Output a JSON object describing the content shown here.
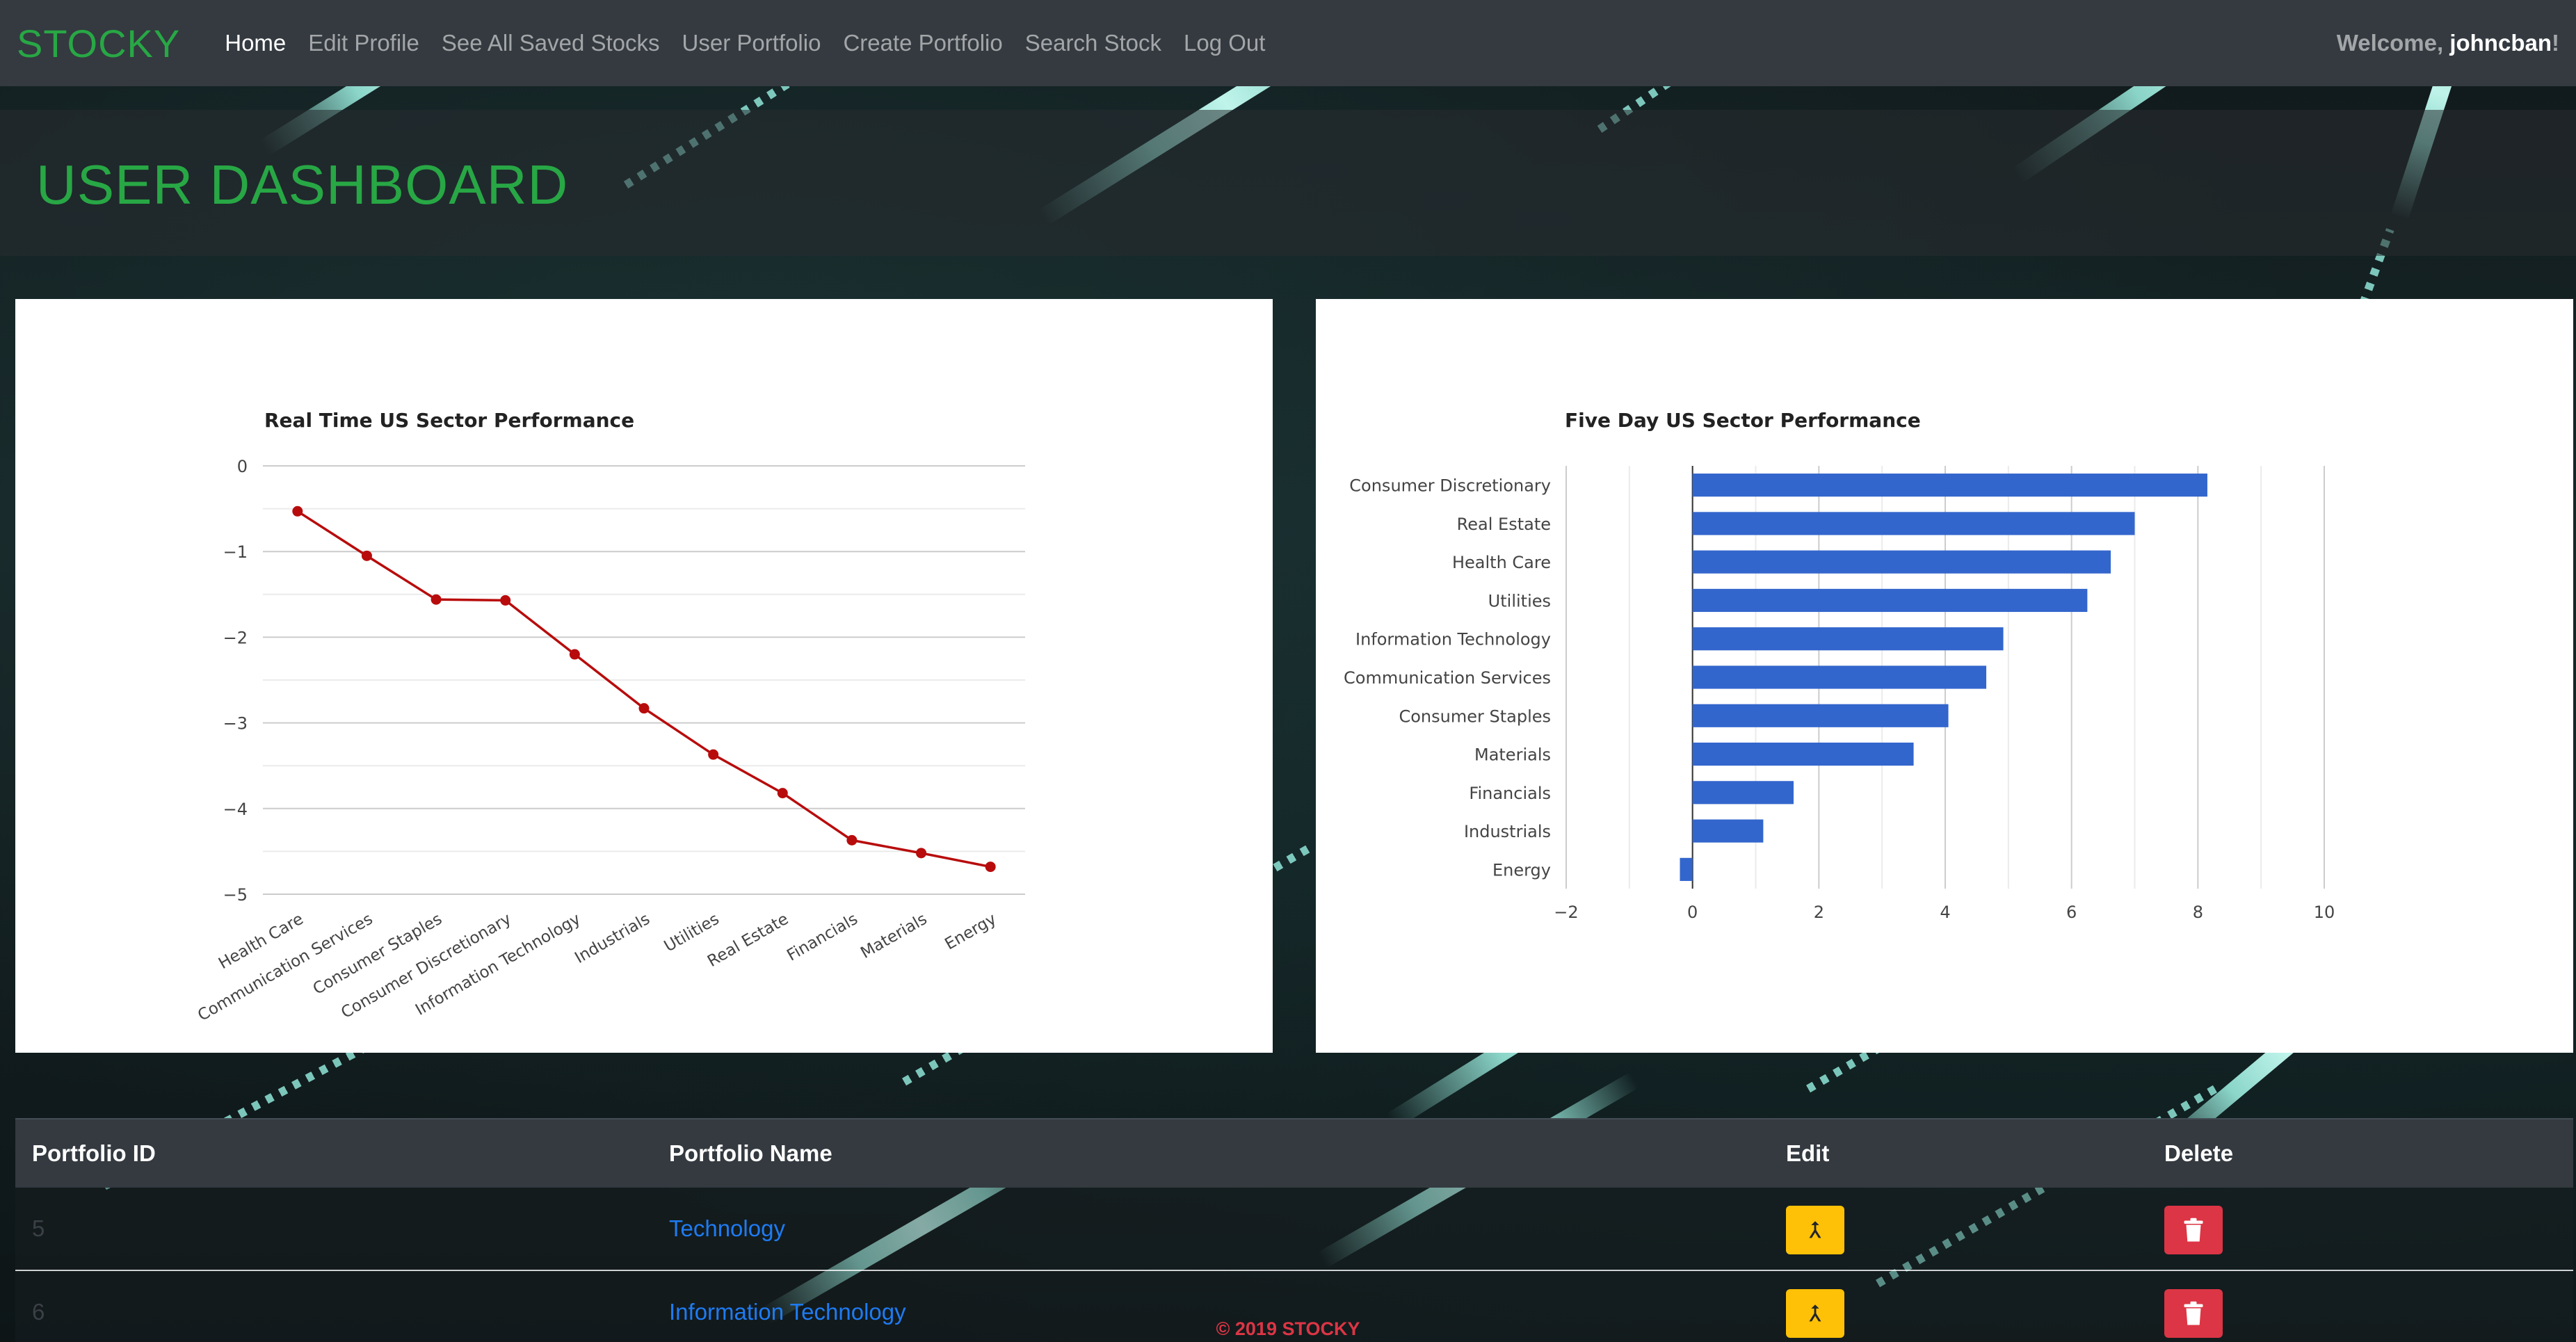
{
  "navbar": {
    "brand": "STOCKY",
    "links": [
      "Home",
      "Edit Profile",
      "See All Saved Stocks",
      "User Portfolio",
      "Create Portfolio",
      "Search Stock",
      "Log Out"
    ],
    "welcome_prefix": "Welcome, ",
    "username": "johncban",
    "welcome_suffix": "!"
  },
  "jumbotron": {
    "title": "USER DASHBOARD"
  },
  "chart_data": [
    {
      "type": "line",
      "title": "Real Time US Sector Performance",
      "categories": [
        "Health Care",
        "Communication Services",
        "Consumer Staples",
        "Consumer Discretionary",
        "Information Technology",
        "Industrials",
        "Utilities",
        "Real Estate",
        "Financials",
        "Materials",
        "Energy"
      ],
      "values": [
        -0.53,
        -1.05,
        -1.56,
        -1.57,
        -2.2,
        -2.83,
        -3.37,
        -3.82,
        -4.37,
        -4.52,
        -4.68
      ],
      "ylim": [
        -5,
        0
      ],
      "yticks": [
        0,
        -1,
        -2,
        -3,
        -4,
        -5
      ],
      "color": "#b80c0c",
      "grid": true
    },
    {
      "type": "bar",
      "orientation": "horizontal",
      "title": "Five Day US Sector Performance",
      "categories": [
        "Consumer Discretionary",
        "Real Estate",
        "Health Care",
        "Utilities",
        "Information Technology",
        "Communication Services",
        "Consumer Staples",
        "Materials",
        "Financials",
        "Industrials",
        "Energy"
      ],
      "values": [
        8.15,
        7.0,
        6.62,
        6.25,
        4.92,
        4.65,
        4.05,
        3.5,
        1.6,
        1.12,
        -0.2
      ],
      "xlim": [
        -2,
        10
      ],
      "xticks": [
        -2,
        0,
        2,
        4,
        6,
        8,
        10
      ],
      "color": "#3366cc",
      "grid": true
    }
  ],
  "table": {
    "headers": [
      "Portfolio ID",
      "Portfolio Name",
      "Edit",
      "Delete"
    ],
    "rows": [
      {
        "id": "5",
        "name": "Technology"
      },
      {
        "id": "6",
        "name": "Information Technology"
      }
    ]
  },
  "footer": {
    "text": "© 2019 STOCKY"
  },
  "colors": {
    "brand": "#28a745",
    "navbar": "#343a40",
    "edit": "#ffc107",
    "delete": "#dc3545",
    "link": "#1e7bf2"
  },
  "icons": {
    "edit": "merge-arrow-icon",
    "delete": "trash-icon"
  }
}
